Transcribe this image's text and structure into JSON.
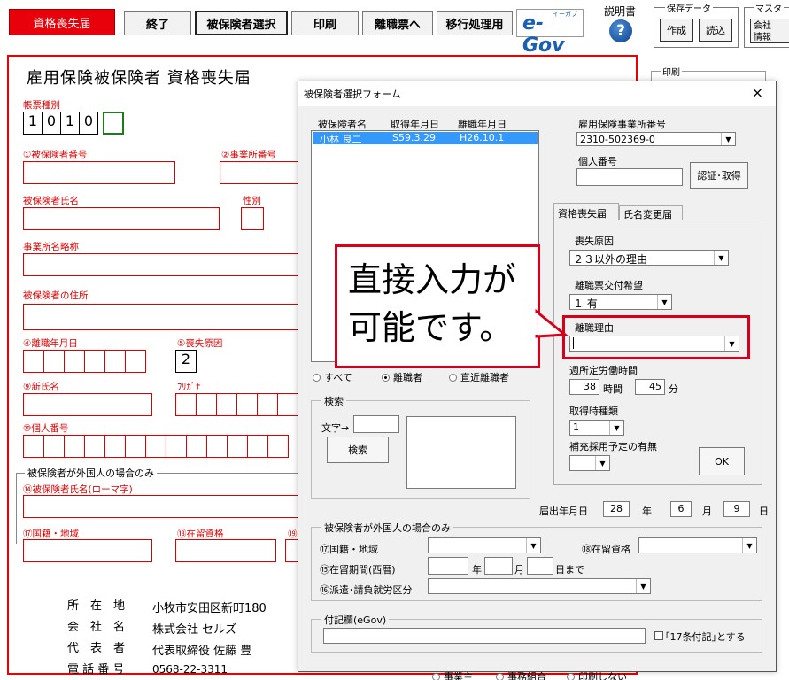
{
  "toolbar": {
    "title_button": "資格喪失届",
    "end": "終了",
    "select_insured": "被保険者選択",
    "print": "印刷",
    "to_separation": "離職票へ",
    "migration": "移行処理用",
    "egov_logo": "e-Gov",
    "egov_sub": "イーガブ",
    "manual": "説明書",
    "help_icon": "?"
  },
  "save_data": {
    "title": "保存データ",
    "create": "作成",
    "load": "読込"
  },
  "master": {
    "title": "マスタ",
    "line1": "会社",
    "line2": "情報"
  },
  "print_group": {
    "title": "印刷"
  },
  "form": {
    "title": "雇用保険被保険者 資格喪失届",
    "form_type_label": "帳票種別",
    "form_type_digits": [
      "1",
      "0",
      "1",
      "0",
      ""
    ],
    "insured_number": "①被保険者番号",
    "office_number": "②事業所番号",
    "insured_name": "被保険者氏名",
    "gender": "性別",
    "office_abbr": "事業所名略称",
    "insured_address": "被保険者の住所",
    "separation_date": "④離職年月日",
    "loss_cause": "⑤喪失原因",
    "loss_cause_value": "2",
    "new_name": "⑨新氏名",
    "furigana": "ﾌﾘｶﾞﾅ",
    "personal_number": "⑩個人番号",
    "foreign_group": "被保険者が外国人の場合のみ",
    "romaji_name": "⑭被保険者氏名(ローマ字)",
    "nationality": "⑰国籍・地域",
    "residence_status": "⑱在留資格",
    "residence_status_short": "⑲",
    "addr_label": "所　在　地",
    "addr_value": "小牧市安田区新町180",
    "company_label": "会　社　名",
    "company_value": "株式会社 セルズ",
    "rep_label": "代　表　者",
    "rep_value": "代表取締役 佐藤 豊",
    "tel_label": "電 話 番 号",
    "tel_value": "0568-22-3311"
  },
  "dialog": {
    "title": "被保険者選択フォーム",
    "close": "×",
    "list_headers": {
      "name": "被保険者名",
      "acquired": "取得年月日",
      "separated": "離職年月日"
    },
    "list_rows": [
      {
        "name": "小林 良二",
        "acquired": "S59.3.29",
        "separated": "H26.10.1"
      }
    ],
    "office_label": "雇用保険事業所番号",
    "office_value": "2310-502369-0",
    "personal_label": "個人番号",
    "personal_value": "",
    "auth_button": "認証･取得",
    "tabs": [
      "資格喪失届",
      "氏名変更届"
    ],
    "loss_cause_label": "喪失原因",
    "loss_cause_value": "２３以外の理由",
    "separation_ticket_label": "離職票交付希望",
    "separation_ticket_value": "１ 有",
    "separation_reason_label": "離職理由",
    "separation_reason_value": "",
    "weekly_hours_label": "週所定労働時間",
    "hours_value": "38",
    "hours_unit": "時間",
    "minutes_value": "45",
    "minutes_unit": "分",
    "acquisition_type_label": "取得時種類",
    "acquisition_type_value": "1",
    "supplement_label": "補充採用予定の有無",
    "supplement_value": "",
    "ok": "OK",
    "radios": [
      "すべて",
      "離職者",
      "直近離職者"
    ],
    "radio_selected": 1,
    "search_group": "検索",
    "search_text_label": "文字→",
    "search_value": "",
    "search_button": "検索",
    "submit_date_label": "届出年月日",
    "submit_year": "28",
    "year_unit": "年",
    "submit_month": "6",
    "month_unit": "月",
    "submit_day": "9",
    "day_unit": "日",
    "foreign_group": "被保険者が外国人の場合のみ",
    "nationality": "⑰国籍・地域",
    "residence_status": "⑱在留資格",
    "stay_period": "⑮在留期間(西暦)",
    "stay_year_unit": "年",
    "stay_month_unit": "月",
    "stay_day_unit": "日まで",
    "dispatch": "⑯派遣･請負就労区分",
    "note_group": "付記欄(eGov)",
    "note_value": "",
    "article17": "｢17条付記｣とする"
  },
  "callout": {
    "line1": "直接入力が",
    "line2": "可能です。"
  },
  "bottom_partial": [
    "事業主",
    "事務組合",
    "印刷しない"
  ],
  "colors": {
    "red": "#e8000a",
    "selection": "#3399ff",
    "callout_border": "#d7001a"
  }
}
